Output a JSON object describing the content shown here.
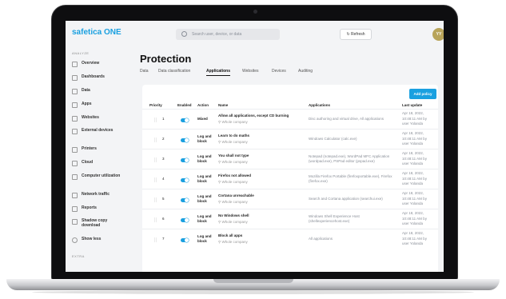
{
  "app": {
    "logo": "safetica ONE",
    "search_placeholder": "Search user, device, or data",
    "refresh_label": "Refresh",
    "avatar_initials": "YY"
  },
  "sidebar": {
    "section_analyze": "ANALYZE",
    "items": [
      {
        "label": "Overview"
      },
      {
        "label": "Dashboards"
      },
      {
        "label": "Data"
      },
      {
        "label": "Apps"
      },
      {
        "label": "Websites"
      },
      {
        "label": "External devices"
      },
      {
        "label": "Printers"
      },
      {
        "label": "Cloud"
      },
      {
        "label": "Computer utilization"
      },
      {
        "label": "Network traffic"
      },
      {
        "label": "Reports"
      },
      {
        "label": "Shadow copy download"
      },
      {
        "label": "Show less"
      }
    ],
    "section_extra": "EXTRA"
  },
  "page": {
    "title": "Protection"
  },
  "tabs": [
    {
      "label": "Data"
    },
    {
      "label": "Data classification"
    },
    {
      "label": "Applications"
    },
    {
      "label": "Websites"
    },
    {
      "label": "Devices"
    },
    {
      "label": "Auditing"
    }
  ],
  "table": {
    "add_button": "Add policy",
    "columns": [
      "Priority",
      "Enabled",
      "Action",
      "Name",
      "Applications",
      "Last update"
    ],
    "rows": [
      {
        "priority": "1",
        "action": "Mixed",
        "name": "Allow all applications, except CD burning",
        "scope": "Whole company",
        "apps": "Disc authoring and virtual drive, All applications",
        "date": "Apr 18, 2022,",
        "time": "10:48:11 AM by",
        "user": "user Yolanda"
      },
      {
        "priority": "2",
        "action": "Log and block",
        "name": "Learn to do maths",
        "scope": "Whole company",
        "apps": "Windows Calculator (calc.exe)",
        "date": "Apr 18, 2022,",
        "time": "10:48:11 AM by",
        "user": "user Yolanda"
      },
      {
        "priority": "3",
        "action": "Log and block",
        "name": "You shall not type",
        "scope": "Whole company",
        "apps": "Notepad (notepad.exe), WordPad MFC Application (wordpad.exe), PSPad editor (pspad.exe)",
        "date": "Apr 18, 2022,",
        "time": "10:48:11 AM by",
        "user": "user Yolanda"
      },
      {
        "priority": "4",
        "action": "Log and block",
        "name": "Firefox not allowed",
        "scope": "Whole company",
        "apps": "Mozilla Firefox Portable (firefoxportable.exe), Firefox (firefox.exe)",
        "date": "Apr 18, 2022,",
        "time": "10:48:11 AM by",
        "user": "user Yolanda"
      },
      {
        "priority": "5",
        "action": "Log and block",
        "name": "Cortana unreachable",
        "scope": "Whole company",
        "apps": "Search and Cortana application (searchui.exe)",
        "date": "Apr 18, 2022,",
        "time": "10:48:11 AM by",
        "user": "user Yolanda"
      },
      {
        "priority": "6",
        "action": "Log and block",
        "name": "No Windows shell",
        "scope": "Whole company",
        "apps": "Windows Shell Experience Host (shellexperiencehost.exe)",
        "date": "Apr 18, 2022,",
        "time": "10:48:11 AM by",
        "user": "user Yolanda"
      },
      {
        "priority": "7",
        "action": "Log and block",
        "name": "Block all apps",
        "scope": "Whole company",
        "apps": "All applications",
        "date": "Apr 18, 2022,",
        "time": "10:48:11 AM by",
        "user": "user Yolanda"
      }
    ]
  },
  "colors": {
    "brand": "#1aa0e0",
    "toggle_on": "#1aa0e0",
    "avatar": "#b8a45a"
  }
}
